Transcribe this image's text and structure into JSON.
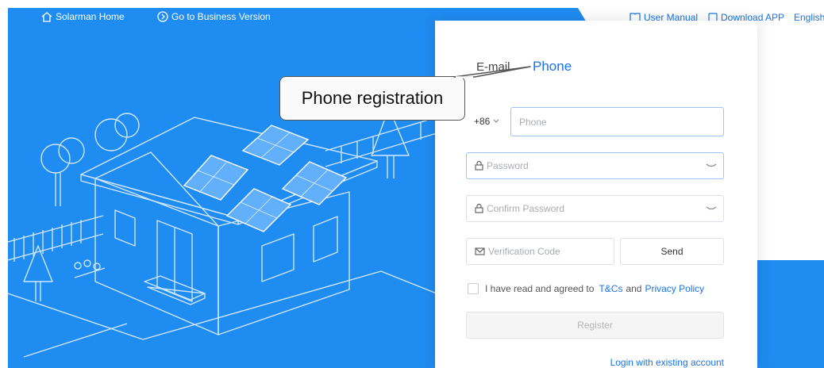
{
  "topnav": {
    "home_label": "Solarman Home",
    "business_label": "Go to Business Version",
    "user_manual_label": "User Manual",
    "download_app_label": "Download APP",
    "language_label": "English"
  },
  "form": {
    "tabs": {
      "email": "E-mail",
      "phone": "Phone"
    },
    "country_code": "+86",
    "phone_placeholder": "Phone",
    "password_placeholder": "Password",
    "confirm_password_placeholder": "Confirm Password",
    "verification_placeholder": "Verification Code",
    "send_label": "Send",
    "agree_text": "I have read and agreed to",
    "tcs_link": "T&Cs",
    "and_text": "and",
    "privacy_link": "Privacy Policy",
    "register_label": "Register",
    "login_link": "Login with existing account"
  },
  "annotation": {
    "callout_text": "Phone registration"
  },
  "colors": {
    "brand_blue": "#1f8cf2",
    "link_blue": "#1a73e8"
  }
}
